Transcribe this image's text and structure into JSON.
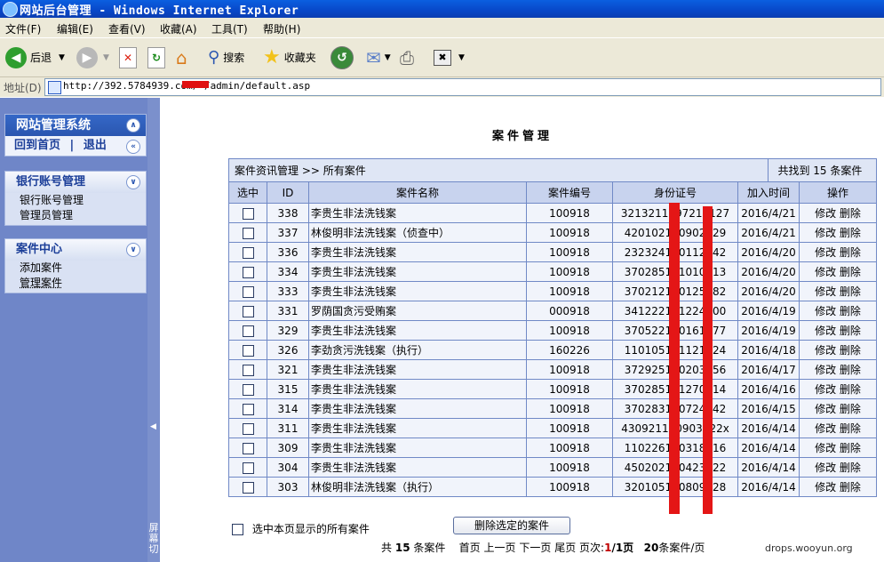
{
  "window": {
    "title": "网站后台管理 - Windows Internet Explorer"
  },
  "menu": [
    "文件(F)",
    "编辑(E)",
    "查看(V)",
    "收藏(A)",
    "工具(T)",
    "帮助(H)"
  ],
  "toolbar": {
    "back": "后退",
    "search": "搜索",
    "favorites": "收藏夹"
  },
  "address": {
    "label": "地址(D)",
    "url": "http://392.5784939.com/      /admin/default.asp"
  },
  "sidebar": {
    "system_title": "网站管理系统",
    "home_link": "回到首页",
    "separator": "|",
    "logout_link": "退出",
    "bank_section": {
      "title": "银行账号管理",
      "items": [
        "银行账号管理",
        "管理员管理"
      ]
    },
    "case_section": {
      "title": "案件中心",
      "items": [
        "添加案件",
        "管理案件"
      ]
    },
    "collapse_text": "屏幕切"
  },
  "main": {
    "page_title": "案件管理",
    "breadcrumb": "案件资讯管理 >> 所有案件",
    "found_count": "共找到 15 条案件",
    "columns": [
      "选中",
      "ID",
      "案件名称",
      "案件编号",
      "身份证号",
      "加入时间",
      "操作"
    ],
    "rows": [
      {
        "id": "338",
        "name": "李贵生非法洗钱案",
        "code": "100918",
        "idcard": "3213211197217127",
        "date": "2016/4/21"
      },
      {
        "id": "337",
        "name": "林俊明非法洗钱案（侦查中）",
        "code": "100918",
        "idcard": "420102190902029",
        "date": "2016/4/21"
      },
      {
        "id": "336",
        "name": "李贵生非法洗钱案",
        "code": "100918",
        "idcard": "232324190112142",
        "date": "2016/4/20"
      },
      {
        "id": "334",
        "name": "李贵生非法洗钱案",
        "code": "100918",
        "idcard": "370285191010213",
        "date": "2016/4/20"
      },
      {
        "id": "333",
        "name": "李贵生非法洗钱案",
        "code": "100918",
        "idcard": "370212190125282",
        "date": "2016/4/20"
      },
      {
        "id": "331",
        "name": "罗荫国贪污受贿案",
        "code": "000918",
        "idcard": "341222191224300",
        "date": "2016/4/19"
      },
      {
        "id": "329",
        "name": "李贵生非法洗钱案",
        "code": "100918",
        "idcard": "370522190161177",
        "date": "2016/4/19"
      },
      {
        "id": "326",
        "name": "李劲贪污洗钱案（执行）",
        "code": "160226",
        "idcard": "110105191121224",
        "date": "2016/4/18"
      },
      {
        "id": "321",
        "name": "李贵生非法洗钱案",
        "code": "100918",
        "idcard": "372925190203356",
        "date": "2016/4/17"
      },
      {
        "id": "315",
        "name": "李贵生非法洗钱案",
        "code": "100918",
        "idcard": "370285191270214",
        "date": "2016/4/16"
      },
      {
        "id": "314",
        "name": "李贵生非法洗钱案",
        "code": "100918",
        "idcard": "370283190724842",
        "date": "2016/4/15"
      },
      {
        "id": "311",
        "name": "李贵生非法洗钱案",
        "code": "100918",
        "idcard": "430921190903222x",
        "date": "2016/4/14"
      },
      {
        "id": "309",
        "name": "李贵生非法洗钱案",
        "code": "100918",
        "idcard": "110226190318516",
        "date": "2016/4/14"
      },
      {
        "id": "304",
        "name": "李贵生非法洗钱案",
        "code": "100918",
        "idcard": "450202190423022",
        "date": "2016/4/14"
      },
      {
        "id": "303",
        "name": "林俊明非法洗钱案（执行）",
        "code": "100918",
        "idcard": "320105190809128",
        "date": "2016/4/14"
      }
    ],
    "edit_label": "修改",
    "delete_label": "删除",
    "select_all_label": "选中本页显示的所有案件",
    "delete_selected_label": "删除选定的案件",
    "pager": {
      "total_prefix": "共",
      "total": "15",
      "total_suffix": "条案件",
      "first": "首页",
      "prev": "上一页",
      "next": "下一页",
      "last": "尾页",
      "page_label": "页次:",
      "current": "1",
      "pages": "/1页",
      "per_page": "20",
      "per_page_suffix": "条案件/页"
    },
    "watermark": "drops.wooyun.org"
  },
  "colors": {
    "accent": "#2a56b0",
    "redaction": "#e41616",
    "grid_border": "#7089c6"
  }
}
